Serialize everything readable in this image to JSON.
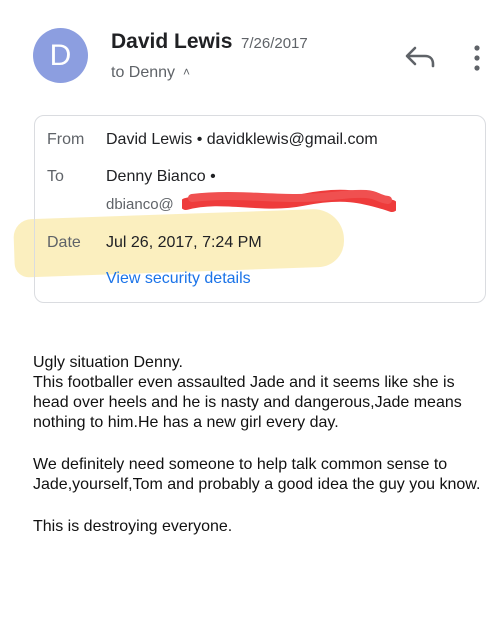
{
  "header": {
    "avatar_initial": "D",
    "sender_name": "David Lewis",
    "date_short": "7/26/2017",
    "to_line": "to Denny",
    "caret": "^",
    "reply_icon": "reply-icon",
    "more_icon": "more-vert-icon"
  },
  "details": {
    "from_label": "From",
    "from_value": "David Lewis • davidklewis@gmail.com",
    "to_label": "To",
    "to_value": "Denny Bianco •",
    "to_email_visible": "dbianco@",
    "date_label": "Date",
    "date_value": "Jul 26, 2017, 7:24 PM",
    "security_link": "View security details"
  },
  "body": {
    "para1_line1": "Ugly situation Denny.",
    "para1_line2": "This footballer even assaulted Jade and it seems like she is head over heels and he is nasty and dangerous,Jade means nothing to him.He has a new girl every day.",
    "para2": "We definitely need someone to help talk common sense to Jade,yourself,Tom and probably a good idea the guy you know.",
    "para3": "This is destroying everyone."
  },
  "colors": {
    "avatar": "#8c9ee0",
    "link": "#1a73e8",
    "highlight": "#f7db72",
    "redaction": "#ee3b3b"
  }
}
